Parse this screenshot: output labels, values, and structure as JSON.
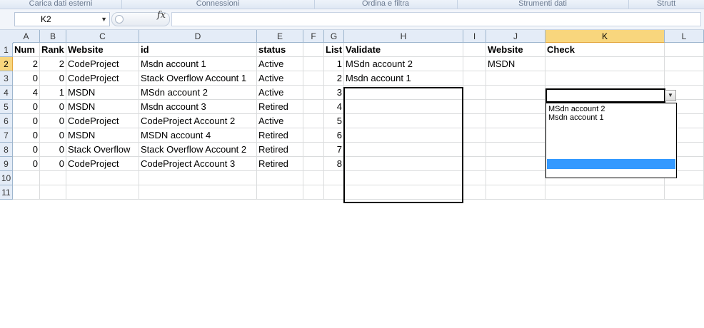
{
  "ribbon_groups": [
    "Carica dati esterni",
    "Connessioni",
    "Ordina e filtra",
    "Strumenti dati",
    "Strutt"
  ],
  "formula_bar": {
    "name_box": "K2",
    "fx_symbol": "fx",
    "formula": ""
  },
  "columns": [
    "A",
    "B",
    "C",
    "D",
    "E",
    "F",
    "G",
    "H",
    "I",
    "J",
    "K",
    "L"
  ],
  "selected_column": "K",
  "rows": [
    "1",
    "2",
    "3",
    "4",
    "5",
    "6",
    "7",
    "8",
    "9",
    "10",
    "11"
  ],
  "selected_row": "2",
  "header_row": {
    "A": "Num",
    "B": "Rank",
    "C": "Website",
    "D": "id",
    "E": "status",
    "G": "List",
    "H": "Validate",
    "J": "Website",
    "K": "Check"
  },
  "data_rows": [
    {
      "A": "2",
      "B": "2",
      "C": "CodeProject",
      "D": "Msdn account 1",
      "E": "Active",
      "G": "1",
      "H": "MSdn account 2",
      "J": "MSDN"
    },
    {
      "A": "0",
      "B": "0",
      "C": "CodeProject",
      "D": "Stack Overflow Account 1",
      "E": "Active",
      "G": "2",
      "H": "Msdn account 1"
    },
    {
      "A": "4",
      "B": "1",
      "C": "MSDN",
      "D": "MSdn account 2",
      "E": "Active",
      "G": "3"
    },
    {
      "A": "0",
      "B": "0",
      "C": "MSDN",
      "D": "Msdn account 3",
      "E": "Retired",
      "G": "4"
    },
    {
      "A": "0",
      "B": "0",
      "C": "CodeProject",
      "D": "CodeProject Account 2",
      "E": "Active",
      "G": "5"
    },
    {
      "A": "0",
      "B": "0",
      "C": "MSDN",
      "D": "MSDN account 4",
      "E": "Retired",
      "G": "6"
    },
    {
      "A": "0",
      "B": "0",
      "C": "Stack Overflow",
      "D": "Stack Overflow Account 2",
      "E": "Retired",
      "G": "7"
    },
    {
      "A": "0",
      "B": "0",
      "C": "CodeProject",
      "D": "CodeProject Account 3",
      "E": "Retired",
      "G": "8"
    }
  ],
  "dropdown": {
    "options": [
      "MSdn account 2",
      "Msdn account 1"
    ],
    "arrow_icon": "chevron-down-icon"
  },
  "colors": {
    "selected_header": "#f8d67d",
    "dropdown_highlight": "#3399ff",
    "header_bg": "#e4ecf7"
  }
}
